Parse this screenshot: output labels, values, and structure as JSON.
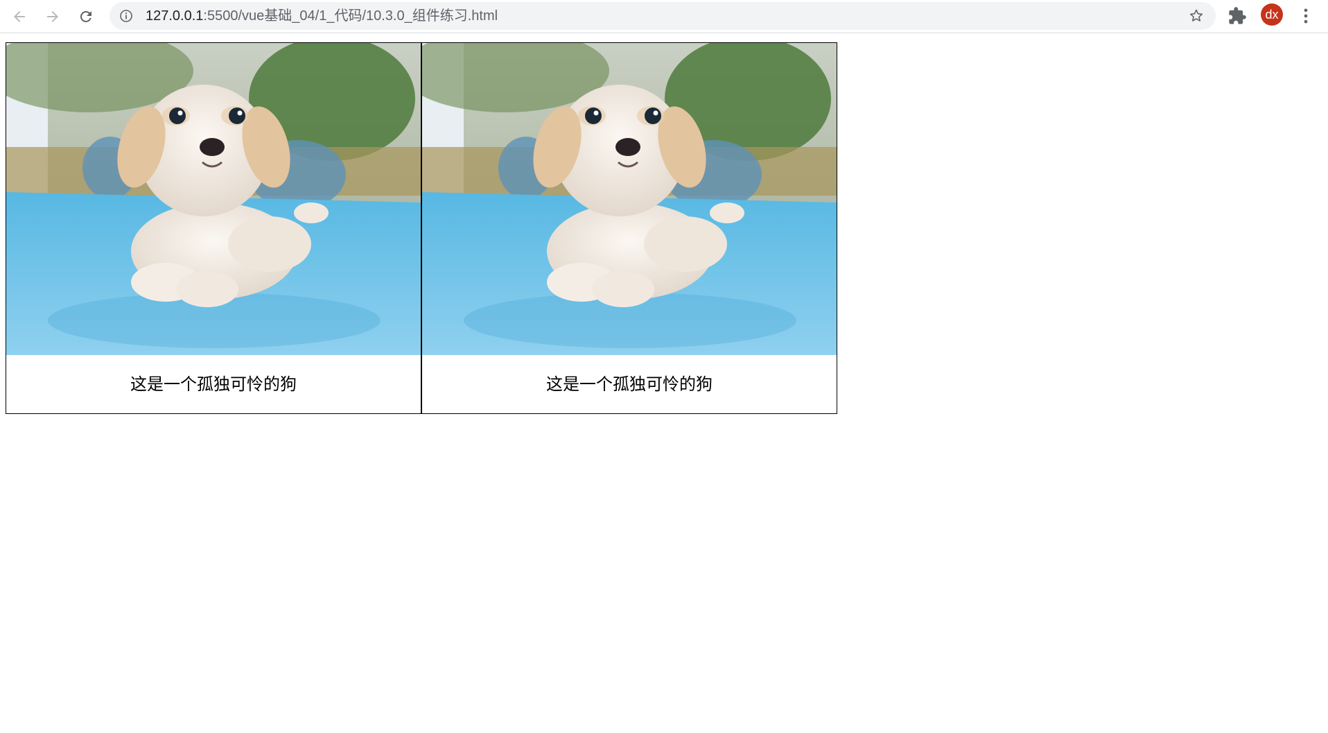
{
  "browser": {
    "url_host": "127.0.0.1",
    "url_rest": ":5500/vue基础_04/1_代码/10.3.0_组件练习.html",
    "profile_initials": "dx",
    "profile_color": "#c5331a"
  },
  "icons": {
    "back": "arrow-left-icon",
    "forward": "arrow-right-icon",
    "reload": "reload-icon",
    "info": "info-icon",
    "bookmark": "star-icon",
    "extensions": "puzzle-icon",
    "menu": "more-vertical-icon"
  },
  "cards": [
    {
      "caption": "这是一个孤独可怜的狗",
      "image": "puppy-on-blue-table"
    },
    {
      "caption": "这是一个孤独可怜的狗",
      "image": "puppy-on-blue-table"
    }
  ]
}
